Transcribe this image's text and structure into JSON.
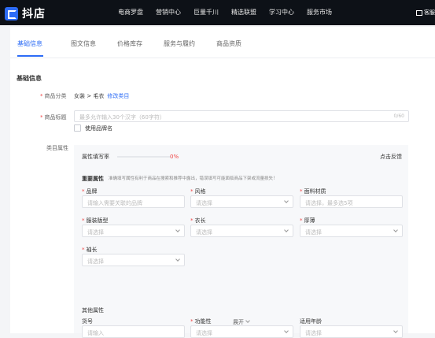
{
  "topbar": {
    "logo_text": "抖店",
    "nav": [
      "电商罗盘",
      "营销中心",
      "巨量千川",
      "精选联盟",
      "学习中心",
      "服务市场"
    ],
    "right_label": "客服"
  },
  "tabs": [
    "基础信息",
    "图文信息",
    "价格库存",
    "服务与履约",
    "商品资质"
  ],
  "section_title": "基础信息",
  "category": {
    "label": "商品分类",
    "value": "女装 > 毛衣",
    "link": "修改类目"
  },
  "title_field": {
    "label": "商品标题",
    "placeholder": "最多允许输入30个汉字（60字符）",
    "counter": "0/60",
    "brand_checkbox_label": "使用品牌名"
  },
  "attributes": {
    "label": "类目属性",
    "fill_rate_label": "属性填写率",
    "fill_rate_value": "0%",
    "feedback": "点击反馈",
    "important_title": "重要属性",
    "important_note": "准确填写属性有利于商品在搜索和推荐中露出，错误填写可能面临商品下架或流量损失！",
    "fields": [
      {
        "label": "品牌",
        "required": true,
        "placeholder": "请输入需要关联的品牌"
      },
      {
        "label": "风格",
        "required": true,
        "placeholder": "请选择"
      },
      {
        "label": "面料材质",
        "required": true,
        "placeholder": "请选择，最多选5项"
      },
      {
        "label": "服装版型",
        "required": true,
        "placeholder": "请选择"
      },
      {
        "label": "衣长",
        "required": true,
        "placeholder": "请选择"
      },
      {
        "label": "厚薄",
        "required": true,
        "placeholder": "请选择"
      },
      {
        "label": "袖长",
        "required": true,
        "placeholder": "请选择"
      }
    ],
    "other_title": "其他属性",
    "other_fields": [
      {
        "label": "货号",
        "required": false,
        "placeholder": "请输入"
      },
      {
        "label": "功能性",
        "required": true,
        "placeholder": "请选择"
      },
      {
        "label": "适用年龄",
        "required": false,
        "placeholder": "请选择"
      }
    ],
    "expand_label": "展开"
  }
}
